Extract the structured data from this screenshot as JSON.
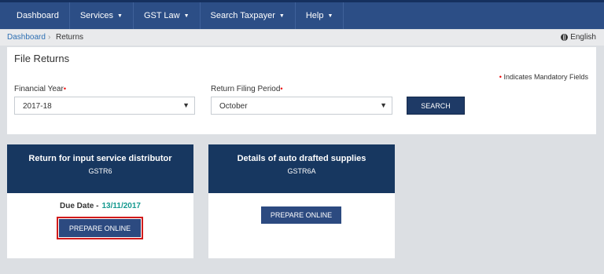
{
  "nav": {
    "dashboard": "Dashboard",
    "services": "Services",
    "gst_law": "GST Law",
    "search_taxpayer": "Search Taxpayer",
    "help": "Help",
    "caret": "▼"
  },
  "breadcrumb": {
    "home": "Dashboard",
    "separator": "›",
    "current": "Returns",
    "language": "English"
  },
  "file_returns": {
    "title": "File Returns",
    "mandatory_note": "Indicates Mandatory Fields",
    "required_mark": "•",
    "financial_year": {
      "label": "Financial Year",
      "value": "2017-18"
    },
    "return_period": {
      "label": "Return Filing Period",
      "value": "October"
    },
    "search_label": "SEARCH",
    "select_arrow": "▼"
  },
  "cards": [
    {
      "title": "Return for input service distributor",
      "form": "GSTR6",
      "due_label": "Due Date -",
      "due_date": "13/11/2017",
      "button": "PREPARE ONLINE"
    },
    {
      "title": "Details of auto drafted supplies",
      "form": "GSTR6A",
      "button": "PREPARE ONLINE"
    }
  ],
  "colors": {
    "nav": "#2c4e86",
    "card_header": "#173760",
    "due_date": "#14998f",
    "highlight": "#d21b1b"
  }
}
